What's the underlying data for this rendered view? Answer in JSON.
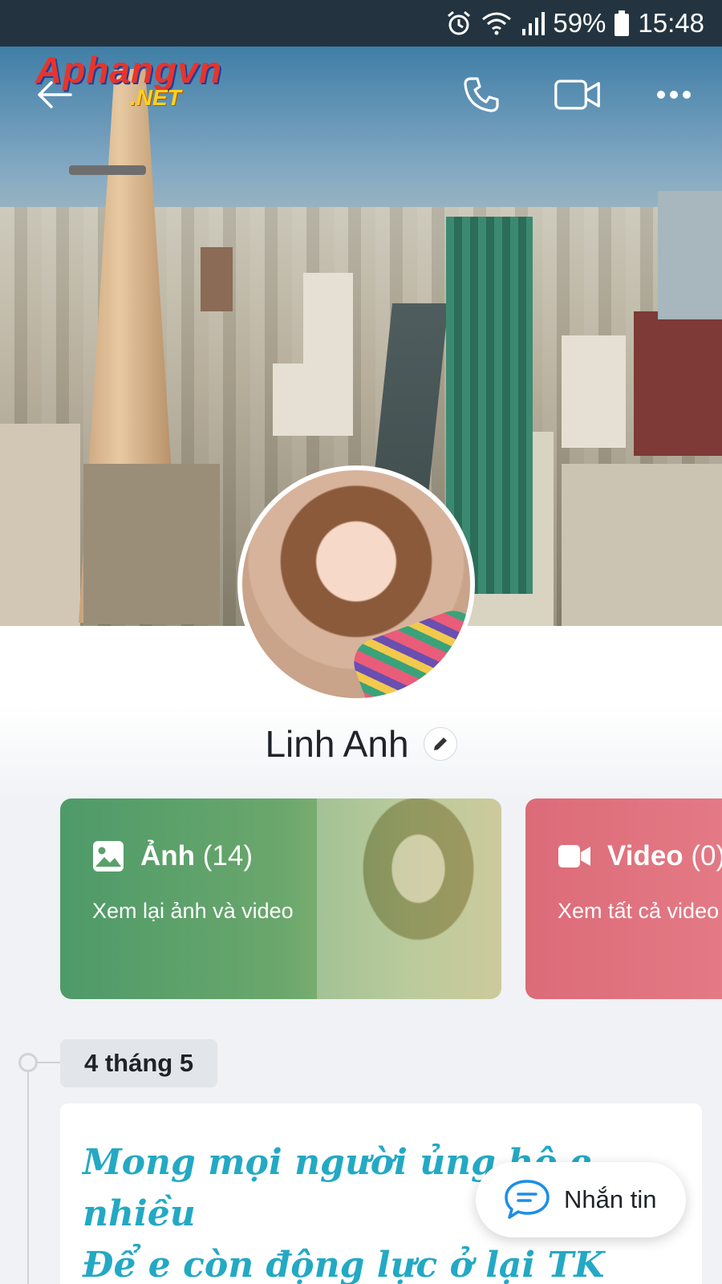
{
  "status_bar": {
    "battery": "59%",
    "time": "15:48",
    "icons": [
      "alarm-icon",
      "wifi-icon",
      "signal-icon",
      "battery-icon"
    ]
  },
  "watermark": {
    "line1": "Aphangvn",
    "line2": ".NET"
  },
  "header": {
    "icons": [
      "back-arrow-icon",
      "phone-icon",
      "video-camera-icon",
      "more-icon"
    ]
  },
  "profile": {
    "name": "Linh Anh"
  },
  "cards": {
    "photos": {
      "title": "Ảnh",
      "count": "(14)",
      "subtitle": "Xem lại ảnh và video"
    },
    "videos": {
      "title": "Video",
      "count": "(0)",
      "subtitle": "Xem tất cả video"
    }
  },
  "timeline": {
    "date": "4 tháng 5",
    "post_text": "Mong mọi người ủng hộ e nhiều\nĐể e còn động lực ở lại TK\nPs: vắng quá"
  },
  "message_button": {
    "label": "Nhắn tin"
  },
  "colors": {
    "status_bar_bg": "#233440",
    "photos_card": "#4e9a69",
    "videos_card": "#dc6b78",
    "post_text": "#23a9c4"
  }
}
